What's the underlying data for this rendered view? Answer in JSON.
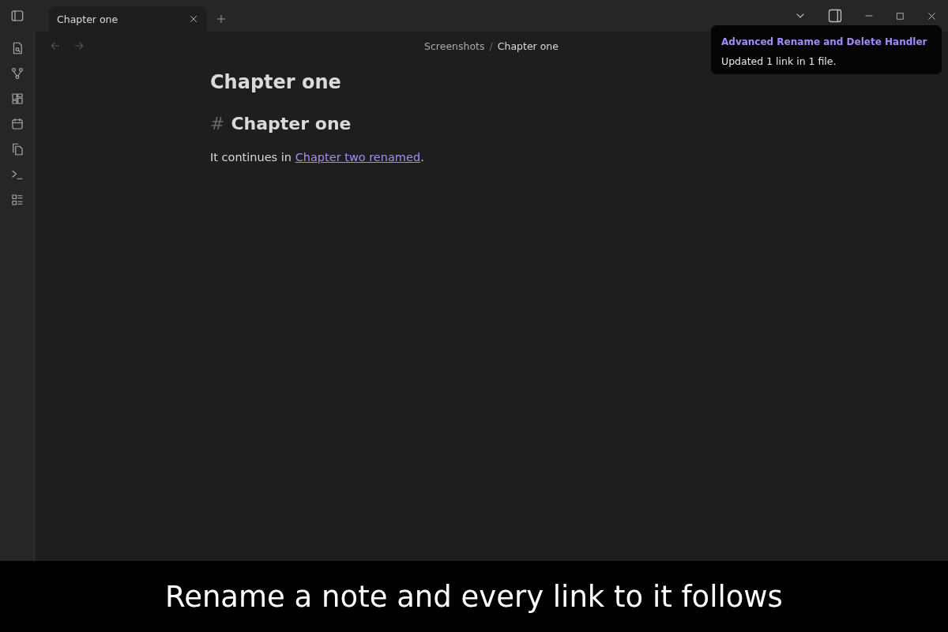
{
  "tabs": [
    {
      "label": "Chapter one",
      "selected": true
    }
  ],
  "breadcrumb": {
    "folder": "Screenshots",
    "separator": "/",
    "note": "Chapter one"
  },
  "note": {
    "title": "Chapter one",
    "heading_mark": "#",
    "heading": "Chapter one",
    "paragraph": {
      "before": "It continues in ",
      "link": "Chapter two renamed",
      "after": "."
    }
  },
  "notice": {
    "title": "Advanced Rename and Delete Handler",
    "message": "Updated 1 link in 1 file."
  },
  "caption": "Rename a note and every link to it follows"
}
